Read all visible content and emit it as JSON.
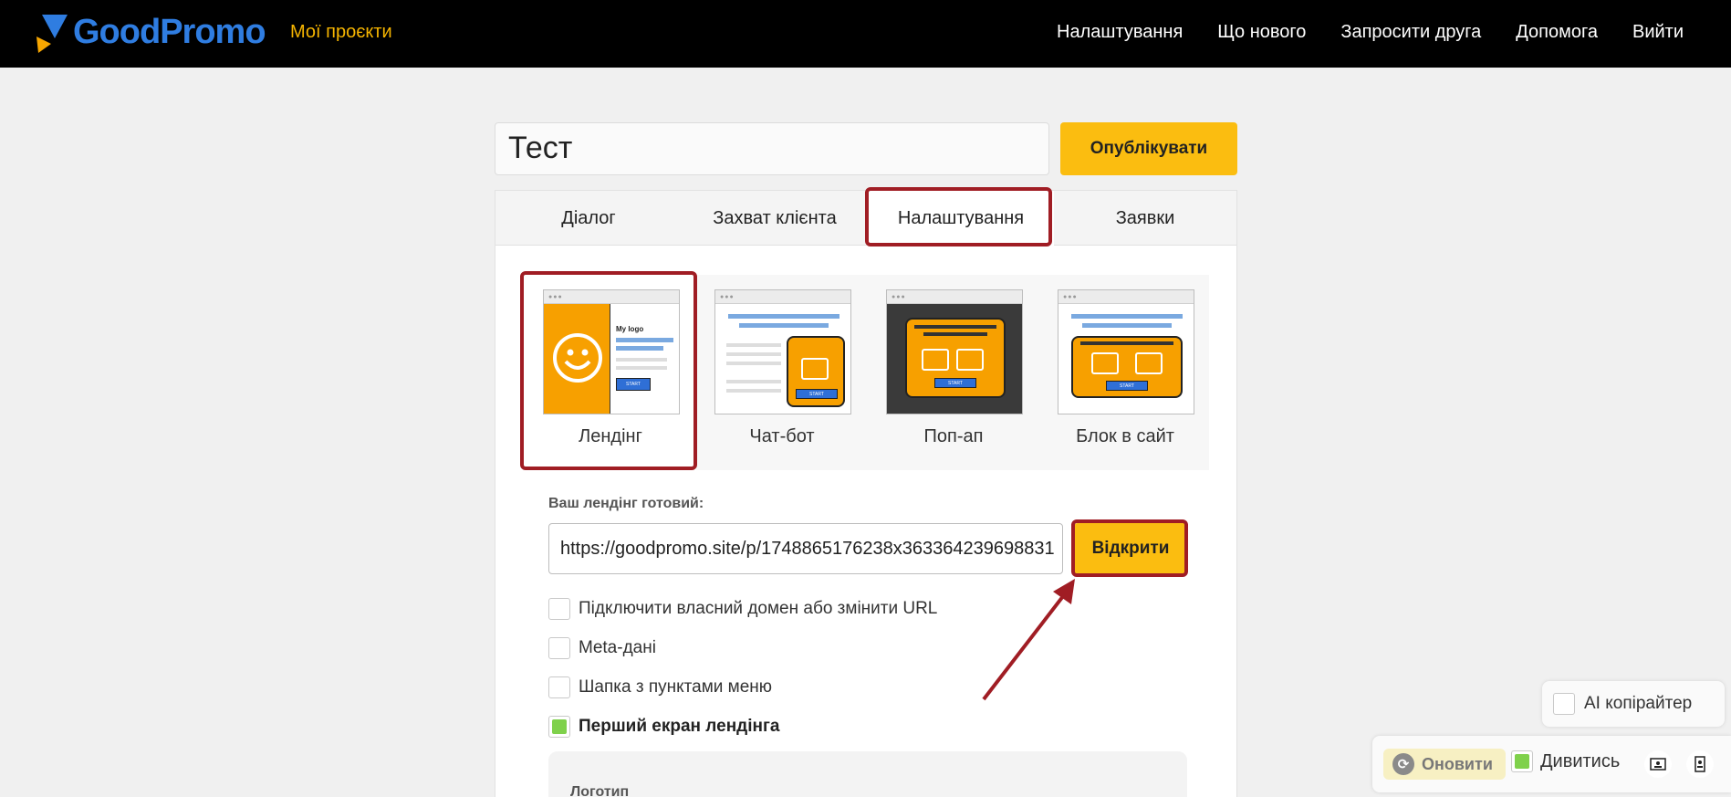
{
  "header": {
    "brand": "GoodPromo",
    "my_projects": "Мої проєкти",
    "nav": [
      "Налаштування",
      "Що нового",
      "Запросити друга",
      "Допомога",
      "Вийти"
    ]
  },
  "project": {
    "title": "Тест",
    "publish_label": "Опублікувати"
  },
  "tabs": [
    {
      "label": "Діалог",
      "active": false
    },
    {
      "label": "Захват клієнта",
      "active": false
    },
    {
      "label": "Налаштування",
      "active": true
    },
    {
      "label": "Заявки",
      "active": false
    }
  ],
  "types": [
    {
      "label": "Лендінг",
      "icon": "landing-thumbnail",
      "active": true,
      "logo_text": "My logo",
      "start": "START"
    },
    {
      "label": "Чат-бот",
      "icon": "chatbot-thumbnail",
      "active": false,
      "start": "START"
    },
    {
      "label": "Поп-ап",
      "icon": "popup-thumbnail",
      "active": false,
      "start": "START"
    },
    {
      "label": "Блок в сайт",
      "icon": "site-block-thumbnail",
      "active": false,
      "start": "START"
    }
  ],
  "landing": {
    "ready_label": "Ваш лендінг готовий:",
    "url": "https://goodpromo.site/p/1748865176238x363364239698831",
    "open_label": "Відкрити"
  },
  "options": [
    {
      "label": "Підключити власний домен або змінити URL",
      "checked": false,
      "bold": false
    },
    {
      "label": "Meta-дані",
      "checked": false,
      "bold": false
    },
    {
      "label": "Шапка з пунктами меню",
      "checked": false,
      "bold": false
    },
    {
      "label": "Перший екран лендінга",
      "checked": true,
      "bold": true
    }
  ],
  "logo_section": {
    "label": "Логотип"
  },
  "widgets": {
    "ai_label": "AI копірайтер ",
    "refresh_label": "Оновити",
    "watch_label": "Дивитись",
    "icons": [
      "refresh-icon",
      "desktop-view-icon",
      "mobile-view-icon"
    ]
  },
  "colors": {
    "accent": "#fbbd10",
    "brand_blue": "#2f7de1",
    "highlight": "#a01d24",
    "checked": "#7fd14b",
    "thumb_orange": "#f7a000"
  }
}
